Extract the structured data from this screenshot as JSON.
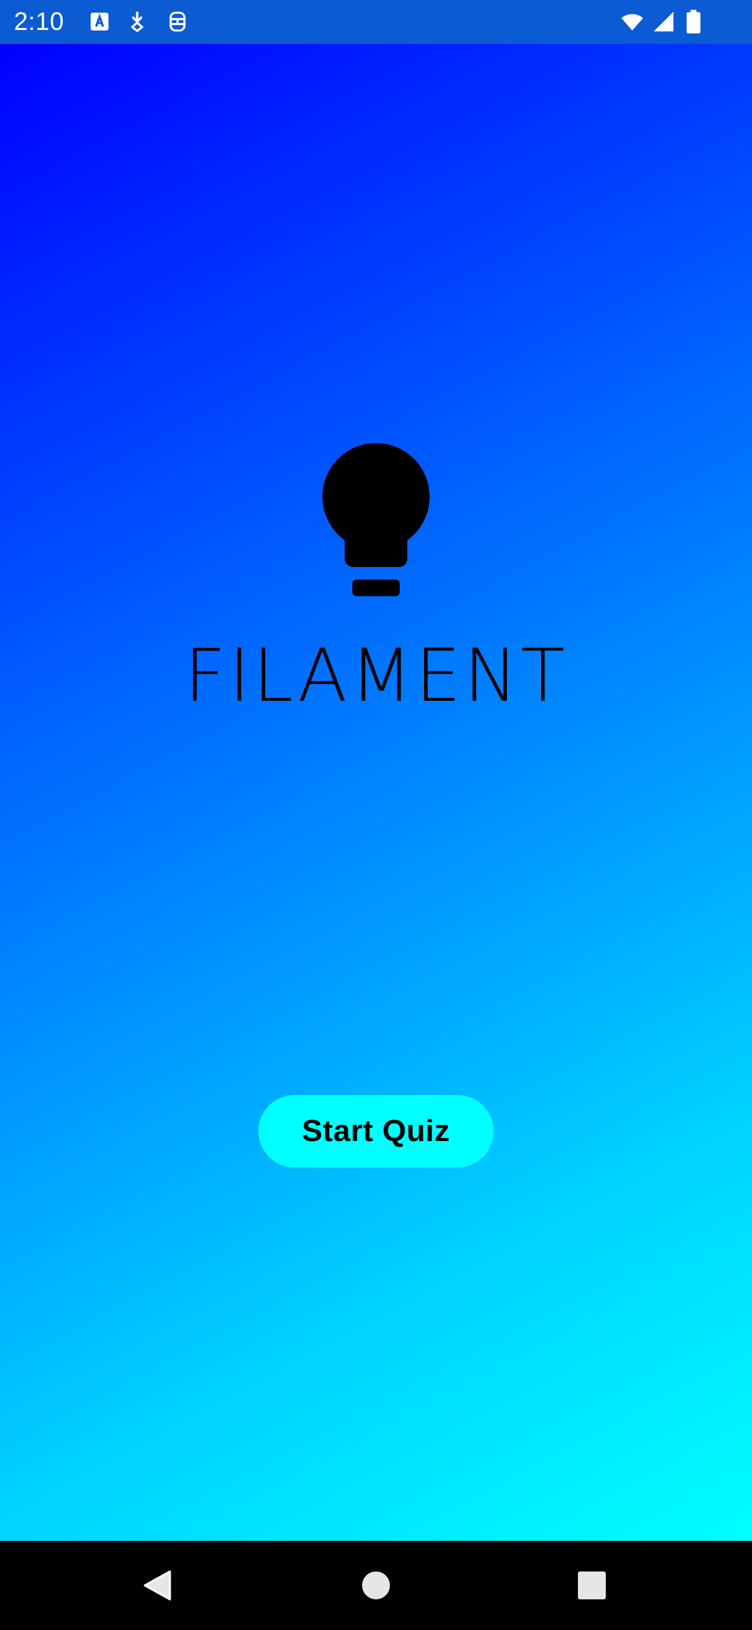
{
  "status_bar": {
    "time": "2:10",
    "background": "#0b5bd3",
    "icons": [
      "app-notification-icon",
      "download-notification-icon",
      "sim-notification-icon",
      "wifi-icon",
      "cellular-signal-icon",
      "battery-icon"
    ]
  },
  "screen": {
    "gradient_start": "#0000ff",
    "gradient_end": "#00ffff"
  },
  "app": {
    "logo_icon": "lightbulb-icon",
    "title": "FILAMENT"
  },
  "start_button": {
    "label": "Start Quiz",
    "background": "#00ffff"
  },
  "nav_bar": {
    "buttons": [
      "back-icon",
      "home-icon",
      "recents-icon"
    ]
  }
}
